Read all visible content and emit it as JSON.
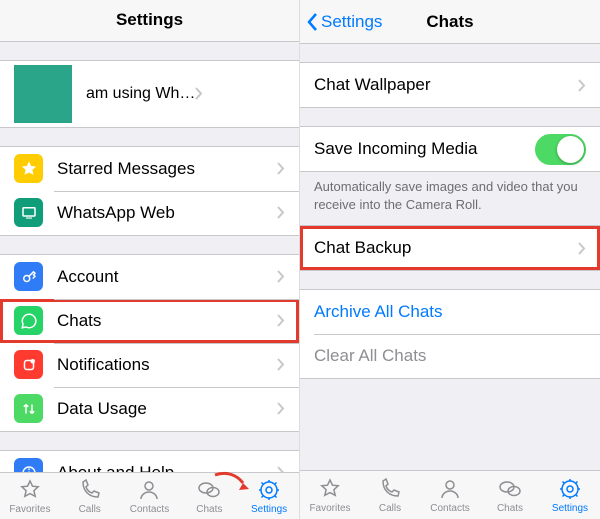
{
  "left": {
    "title": "Settings",
    "profile_status": "am using Wh…",
    "group1": [
      {
        "label": "Starred Messages",
        "icon": "star",
        "bg": "#ffcc00"
      },
      {
        "label": "WhatsApp Web",
        "icon": "web",
        "bg": "#0f9d7a"
      }
    ],
    "group2": [
      {
        "label": "Account",
        "icon": "key",
        "bg": "#2f7cf6"
      },
      {
        "label": "Chats",
        "icon": "chat",
        "bg": "#25d366",
        "highlight": true
      },
      {
        "label": "Notifications",
        "icon": "bell",
        "bg": "#ff3b30"
      },
      {
        "label": "Data Usage",
        "icon": "data",
        "bg": "#4cd964"
      }
    ],
    "group3": [
      {
        "label": "About and Help",
        "icon": "info",
        "bg": "#2f7cf6"
      }
    ],
    "tabs": [
      "Favorites",
      "Calls",
      "Contacts",
      "Chats",
      "Settings"
    ],
    "active_tab": 4
  },
  "right": {
    "back": "Settings",
    "title": "Chats",
    "wallpaper": "Chat Wallpaper",
    "save_media": "Save Incoming Media",
    "save_media_on": true,
    "save_media_footer": "Automatically save images and video that you receive into the Camera Roll.",
    "chat_backup": "Chat Backup",
    "archive": "Archive All Chats",
    "clear": "Clear All Chats",
    "tabs": [
      "Favorites",
      "Calls",
      "Contacts",
      "Chats",
      "Settings"
    ],
    "active_tab": 4
  },
  "colors": {
    "accent": "#007aff",
    "toggle_on": "#4cd964",
    "highlight": "#e23b2e"
  }
}
